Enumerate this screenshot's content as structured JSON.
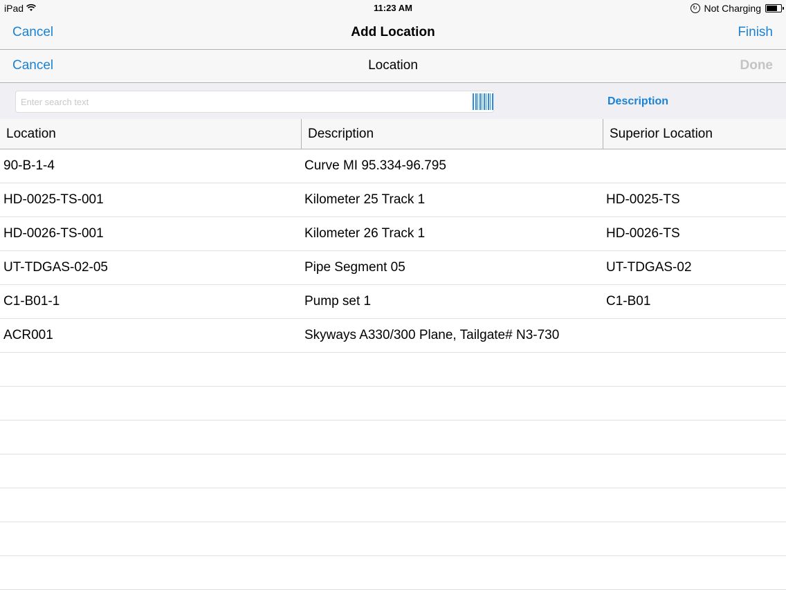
{
  "status_bar": {
    "device": "iPad",
    "time": "11:23 AM",
    "charging": "Not Charging"
  },
  "nav_top": {
    "cancel": "Cancel",
    "title": "Add Location",
    "finish": "Finish"
  },
  "nav_sub": {
    "cancel": "Cancel",
    "title": "Location",
    "done": "Done"
  },
  "search": {
    "placeholder": "Enter search text",
    "filter_label": "Description"
  },
  "table": {
    "headers": [
      "Location",
      "Description",
      "Superior Location"
    ],
    "rows": [
      [
        "90-B-1-4",
        "Curve MI 95.334-96.795",
        ""
      ],
      [
        "HD-0025-TS-001",
        "Kilometer 25 Track 1",
        "HD-0025-TS"
      ],
      [
        "HD-0026-TS-001",
        "Kilometer 26 Track 1",
        "HD-0026-TS"
      ],
      [
        "UT-TDGAS-02-05",
        "Pipe Segment 05",
        "UT-TDGAS-02"
      ],
      [
        "C1-B01-1",
        "Pump set 1",
        "C1-B01"
      ],
      [
        "ACR001",
        "Skyways A330/300 Plane, Tailgate# N3-730",
        ""
      ],
      [
        "",
        "",
        ""
      ],
      [
        "",
        "",
        ""
      ],
      [
        "",
        "",
        ""
      ],
      [
        "",
        "",
        ""
      ],
      [
        "",
        "",
        ""
      ],
      [
        "",
        "",
        ""
      ],
      [
        "",
        "",
        ""
      ]
    ]
  },
  "colors": {
    "accent": "#1a82d3",
    "disabled": "#c4c4c4",
    "bar_bg": "#f7f7f7"
  }
}
